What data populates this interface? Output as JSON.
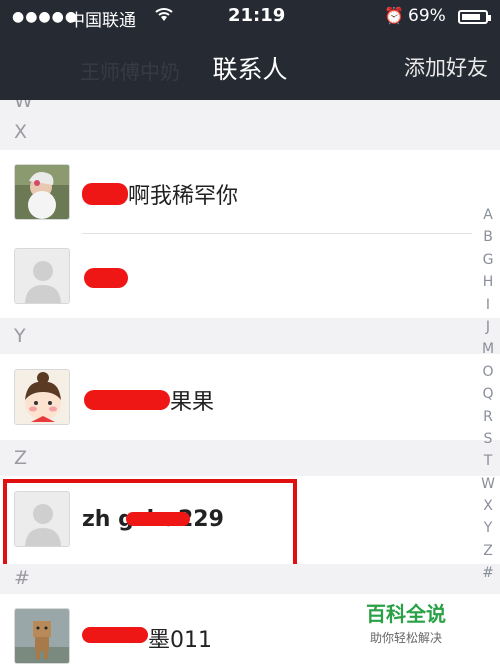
{
  "status_bar": {
    "signal": "●●●●●",
    "carrier": "中国联通",
    "wifi_icon": "wifi-icon",
    "time": "21:19",
    "alarm_icon": "alarm-icon",
    "battery_percent": "69%",
    "battery_level": 0.69
  },
  "nav": {
    "title": "联系人",
    "add_friend": "添加好友",
    "ghost_text": "王师傅中奶"
  },
  "sections": {
    "w": "W",
    "x": "X",
    "y": "Y",
    "z": "Z",
    "hash": "#"
  },
  "contacts": [
    {
      "name": "啊我稀罕你",
      "avatar": "old-man-photo"
    },
    {
      "name": "",
      "avatar": "default-avatar"
    },
    {
      "name": "果果",
      "avatar": "cartoon-girl"
    },
    {
      "name": "zh gzhu229",
      "avatar": "default-avatar"
    },
    {
      "name": "墨011",
      "avatar": "cardboard-figure"
    }
  ],
  "index_letters": [
    "A",
    "B",
    "G",
    "H",
    "I",
    "J",
    "M",
    "O",
    "Q",
    "R",
    "S",
    "T",
    "W",
    "X",
    "Y",
    "Z",
    "#"
  ],
  "watermark": {
    "title": "百科全说",
    "subtitle": "助你轻松解决"
  },
  "colors": {
    "nav_bg": "#262a33",
    "highlight_red": "#e01010",
    "watermark_green": "#2aa146"
  }
}
